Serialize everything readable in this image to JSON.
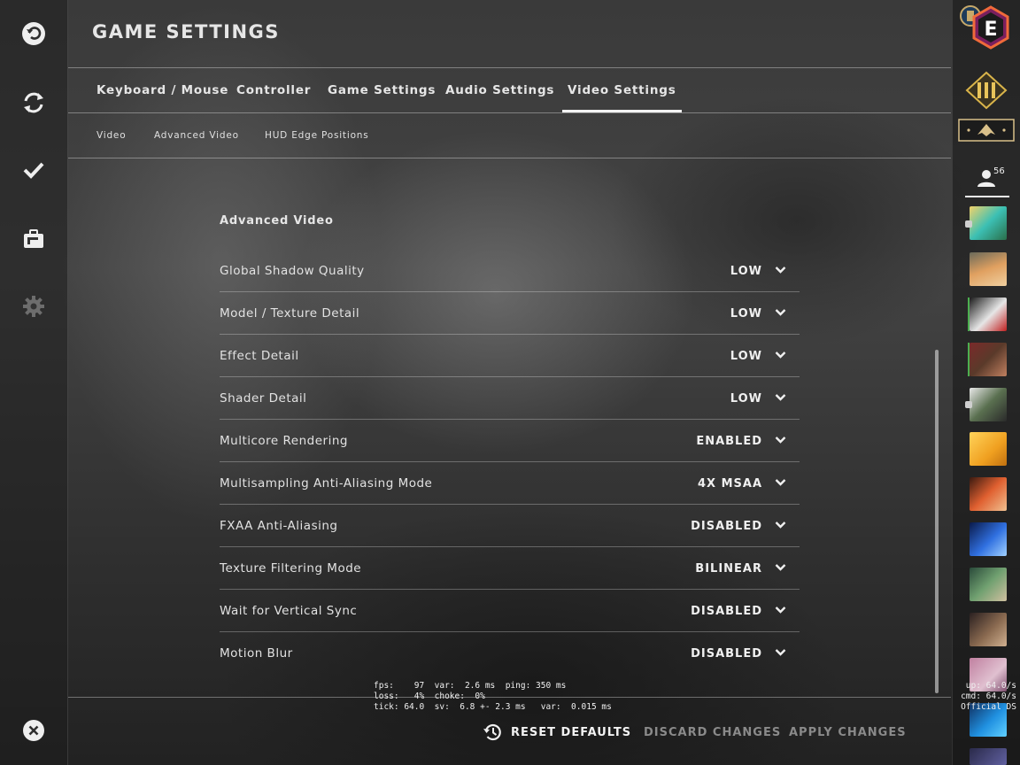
{
  "page": {
    "title": "GAME SETTINGS"
  },
  "left_rail": {
    "items": [
      "back-icon",
      "sync-icon",
      "checkmark-icon",
      "inventory-icon",
      "gear-icon",
      "close-icon"
    ]
  },
  "tabs": [
    {
      "label": "Keyboard / Mouse",
      "active": false
    },
    {
      "label": "Controller",
      "active": false
    },
    {
      "label": "Game Settings",
      "active": false
    },
    {
      "label": "Audio Settings",
      "active": false
    },
    {
      "label": "Video Settings",
      "active": true
    }
  ],
  "subtabs": [
    {
      "label": "Video"
    },
    {
      "label": "Advanced Video"
    },
    {
      "label": "HUD Edge Positions"
    }
  ],
  "section": {
    "title": "Advanced Video"
  },
  "settings": [
    {
      "label": "Global Shadow Quality",
      "value": "LOW"
    },
    {
      "label": "Model / Texture Detail",
      "value": "LOW"
    },
    {
      "label": "Effect Detail",
      "value": "LOW"
    },
    {
      "label": "Shader Detail",
      "value": "LOW"
    },
    {
      "label": "Multicore Rendering",
      "value": "ENABLED"
    },
    {
      "label": "Multisampling Anti-Aliasing Mode",
      "value": "4X MSAA"
    },
    {
      "label": "FXAA Anti-Aliasing",
      "value": "DISABLED"
    },
    {
      "label": "Texture Filtering Mode",
      "value": "BILINEAR"
    },
    {
      "label": "Wait for Vertical Sync",
      "value": "DISABLED"
    },
    {
      "label": "Motion Blur",
      "value": "DISABLED"
    }
  ],
  "netgraph": {
    "line1": "fps:    97  var:  2.6 ms  ping: 350 ms",
    "line2": "loss:   4%  choke:  0%",
    "line3": "tick: 64.0  sv:  6.8 +- 2.3 ms   var:  0.015 ms",
    "right1": "up: 64.0/s",
    "right2": "cmd: 64.0/s",
    "right3": "Official DS"
  },
  "actions": {
    "reset": "RESET DEFAULTS",
    "discard": "DISCARD CHANGES",
    "apply": "APPLY CHANGES"
  },
  "right_rail": {
    "friends_count": "56",
    "rank_letter": "E"
  },
  "colors": {
    "accent_white": "#f0f0f0",
    "disabled_text": "#8a8a8a",
    "online_green": "#4caf50"
  }
}
